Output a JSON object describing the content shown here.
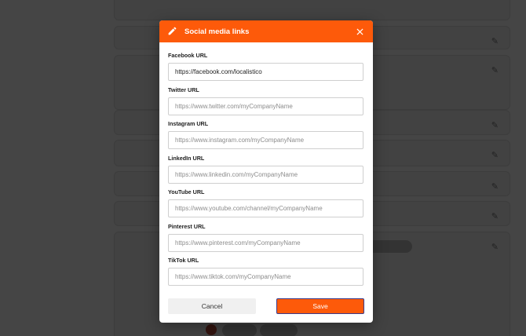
{
  "modal": {
    "title": "Social media links",
    "fields": [
      {
        "label": "Facebook URL",
        "value": "https://facebook.com/localistico",
        "placeholder": ""
      },
      {
        "label": "Twitter URL",
        "value": "",
        "placeholder": "https://www.twitter.com/myCompanyName"
      },
      {
        "label": "Instagram URL",
        "value": "",
        "placeholder": "https://www.instagram.com/myCompanyName"
      },
      {
        "label": "LinkedIn URL",
        "value": "",
        "placeholder": "https://www.linkedin.com/myCompanyName"
      },
      {
        "label": "YouTube URL",
        "value": "",
        "placeholder": "https://www.youtube.com/channel/myCompanyName"
      },
      {
        "label": "Pinterest URL",
        "value": "",
        "placeholder": "https://www.pinterest.com/myCompanyName"
      },
      {
        "label": "TikTok URL",
        "value": "",
        "placeholder": "https://www.tiktok.com/myCompanyName"
      }
    ],
    "cancel_label": "Cancel",
    "save_label": "Save"
  },
  "colors": {
    "accent": "#fd5a0a",
    "overlay": "rgba(0,0,0,0.73)"
  },
  "icons": {
    "header": "pencil-icon",
    "close": "close-icon",
    "background_edit": "pencil-icon"
  }
}
